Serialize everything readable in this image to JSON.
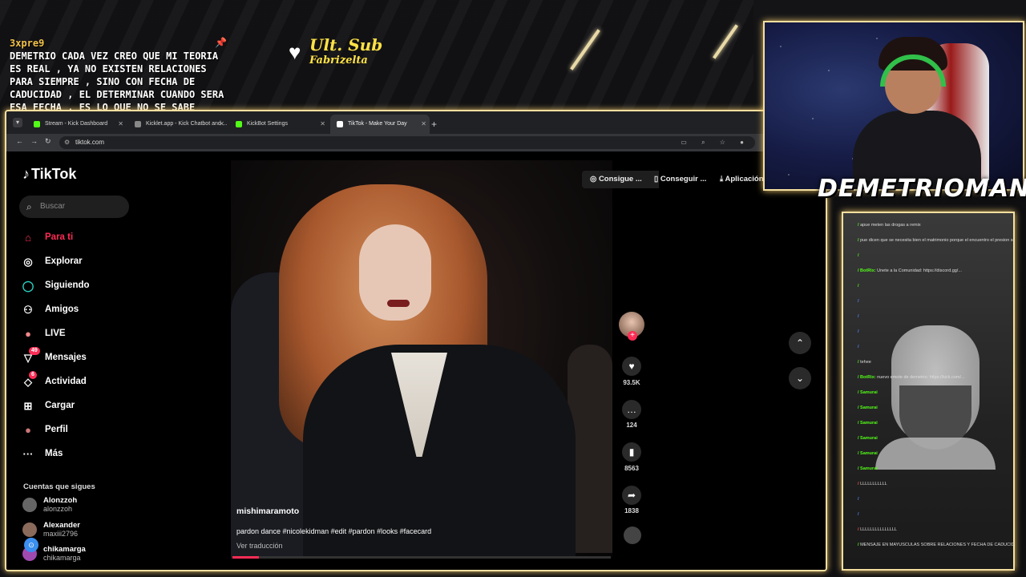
{
  "overlay": {
    "chat_user": "3xpre9",
    "chat_message": "DEMETRIO CADA VEZ CREO QUE MI TEORIA ES REAL , YA NO EXISTEN RELACIONES PARA SIEMPRE , SINO CON FECHA DE CADUCIDAD , EL DETERMINAR CUANDO SERA ESA FECHA , ES LO QUE NO SE SABE",
    "sub_title": "Ult. Sub",
    "sub_name": "Fabrizelta",
    "streamer_name": "DEMETRIOMAN..."
  },
  "browser": {
    "tabs": [
      {
        "label": "Stream - Kick Dashboard",
        "color": "#53fc18"
      },
      {
        "label": "Kicklet.app - Kick Chatbot and ...",
        "color": "#888888"
      },
      {
        "label": "KickBot Settings",
        "color": "#53fc18"
      },
      {
        "label": "TikTok - Make Your Day",
        "color": "#ffffff"
      }
    ],
    "new_tab": "+",
    "url": "tiktok.com"
  },
  "tiktok": {
    "logo": "TikTok",
    "search_placeholder": "Buscar",
    "nav": [
      {
        "label": "Para ti",
        "icon": "home-icon",
        "glyph": "⌂"
      },
      {
        "label": "Explorar",
        "icon": "compass-icon",
        "glyph": "◎"
      },
      {
        "label": "Siguiendo",
        "icon": "following-icon",
        "glyph": "◯"
      },
      {
        "label": "Amigos",
        "icon": "friends-icon",
        "glyph": "⚇"
      },
      {
        "label": "LIVE",
        "icon": "live-icon",
        "glyph": "●"
      },
      {
        "label": "Mensajes",
        "icon": "messages-icon",
        "glyph": "▽",
        "badge": "49"
      },
      {
        "label": "Actividad",
        "icon": "activity-icon",
        "glyph": "◇",
        "badge": "6"
      },
      {
        "label": "Cargar",
        "icon": "upload-icon",
        "glyph": "⊞"
      },
      {
        "label": "Perfil",
        "icon": "profile-icon",
        "glyph": "●"
      },
      {
        "label": "Más",
        "icon": "more-icon",
        "glyph": "···"
      }
    ],
    "following_title": "Cuentas que sigues",
    "following": [
      {
        "name": "Alonzzoh",
        "handle": "alonzzoh"
      },
      {
        "name": "Alexander",
        "handle": "maxiii2796"
      },
      {
        "name": "chikamarga",
        "handle": "chikamarga"
      }
    ],
    "top_actions": [
      "Consigue ...",
      "Conseguir ...",
      "Aplicación"
    ],
    "video": {
      "username": "mishimaramoto",
      "description": "pardon dance #nicolekidman #edit #pardon #looks #facecard",
      "translate": "Ver traducción",
      "progress": 0.07
    },
    "rail": {
      "likes": "93.5K",
      "comments": "124",
      "saves": "8563",
      "shares": "1838"
    }
  },
  "kick_chat": [
    {
      "user": "",
      "text": "apue meten las drogas a remix",
      "color": "green"
    },
    {
      "user": "",
      "text": "pue dicen que se necesita bien el matrimonio porque el encuentro el presion social, adentro del matrimonio cuantos cambios hay",
      "color": "green"
    },
    {
      "user": "",
      "text": "",
      "color": "green"
    },
    {
      "user": "BotRix:",
      "text": "Unete a la Comunidad: https://discord.gg/...",
      "color": "green"
    },
    {
      "user": "",
      "text": "",
      "color": "green"
    },
    {
      "user": "",
      "text": "",
      "color": "blue"
    },
    {
      "user": "",
      "text": "",
      "color": "blue"
    },
    {
      "user": "",
      "text": "",
      "color": "blue"
    },
    {
      "user": "",
      "text": "",
      "color": "blue"
    },
    {
      "user": "",
      "text": "tehee",
      "color": "green"
    },
    {
      "user": "BotRix:",
      "text": "nuevo emote de demetrio: https://kick.com/...",
      "color": "green"
    },
    {
      "user": "Samurai",
      "text": "",
      "color": "green"
    },
    {
      "user": "Samurai",
      "text": "",
      "color": "green"
    },
    {
      "user": "Samurai",
      "text": "",
      "color": "green"
    },
    {
      "user": "Samurai",
      "text": "",
      "color": "green"
    },
    {
      "user": "Samurai",
      "text": "",
      "color": "green"
    },
    {
      "user": "Samurai",
      "text": "",
      "color": "green"
    },
    {
      "user": "",
      "text": "LLLLLLLLLLL",
      "color": "red"
    },
    {
      "user": "",
      "text": "",
      "color": "blue"
    },
    {
      "user": "",
      "text": "",
      "color": "blue"
    },
    {
      "user": "",
      "text": "LLLLLLLLLLLLLLL",
      "color": "red"
    },
    {
      "user": "",
      "text": "MENSAJE EN MAYUSCULAS SOBRE RELACIONES Y FECHA DE CADUCIDAD",
      "color": "white"
    }
  ]
}
